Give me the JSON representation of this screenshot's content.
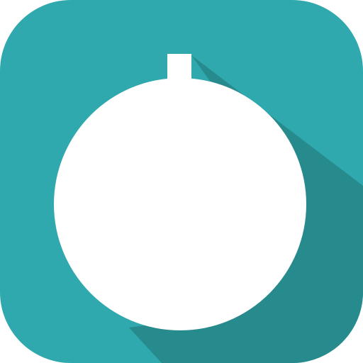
{
  "app_icon": {
    "glyph": "stopwatch-icon",
    "colors": {
      "tile": "#2fa9ad",
      "long_shadow": "#278a8d",
      "glyph": "#ffffff"
    }
  }
}
